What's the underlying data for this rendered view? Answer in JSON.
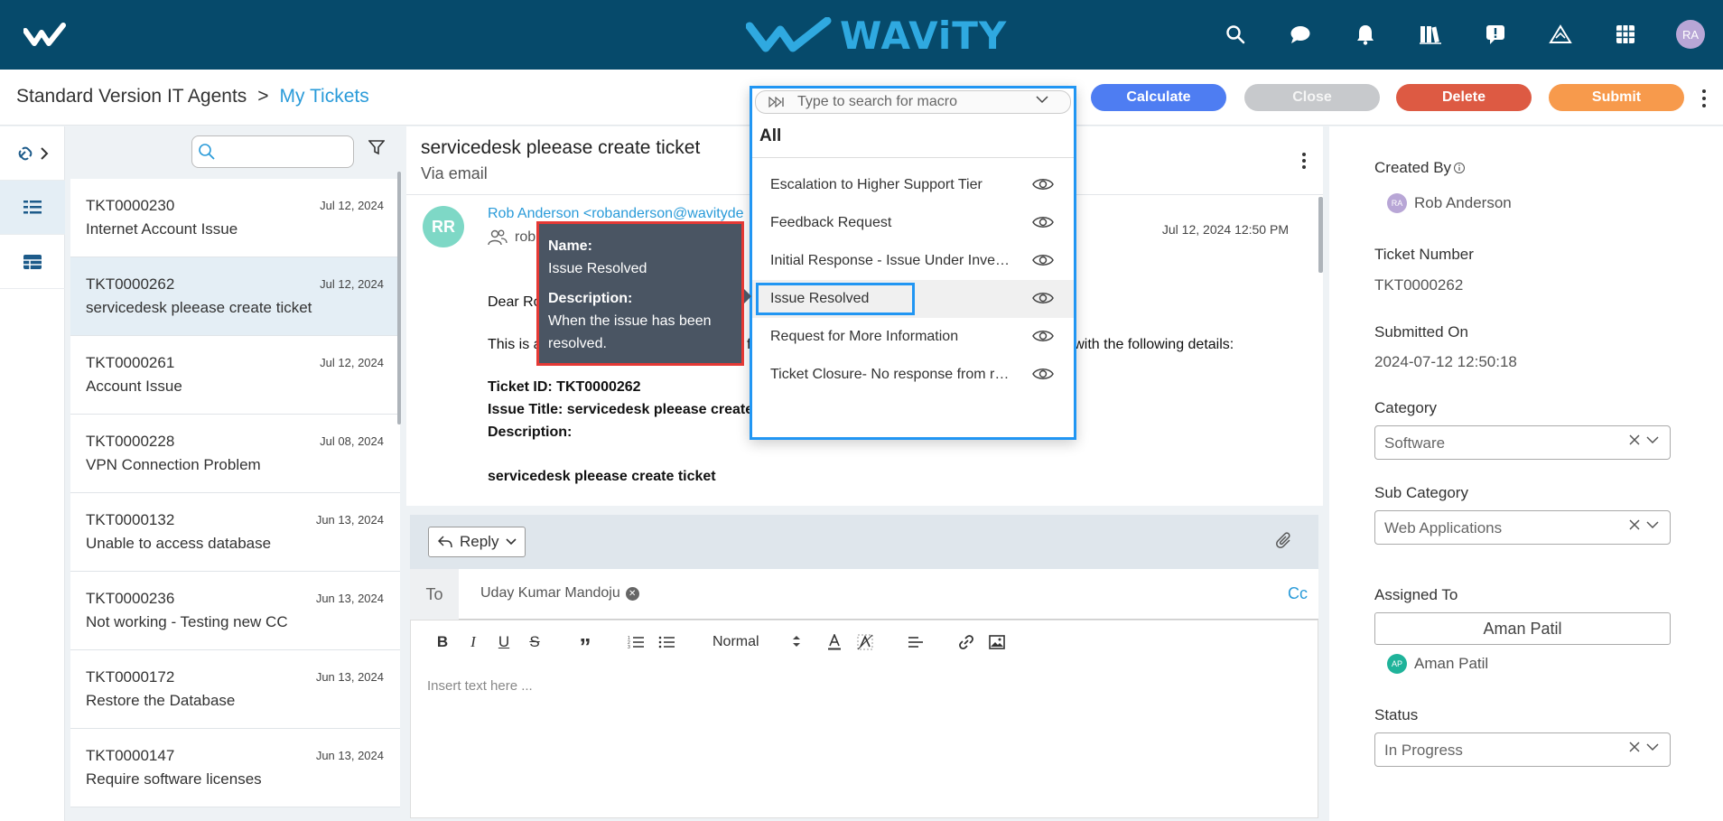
{
  "brand": {
    "name": "WAViTY"
  },
  "topbar": {
    "icons": [
      "search-icon",
      "chat-icon",
      "bell-icon",
      "library-icon",
      "feedback-icon",
      "alert-icon",
      "apps-grid-icon"
    ],
    "user_initials": "RA"
  },
  "breadcrumb": {
    "root": "Standard Version IT Agents",
    "separator": ">",
    "current": "My Tickets"
  },
  "actions": {
    "calculate": "Calculate",
    "close": "Close",
    "delete": "Delete",
    "submit": "Submit"
  },
  "macro": {
    "placeholder": "Type to search for macro",
    "group": "All",
    "items": [
      {
        "label": "Escalation to Higher Support Tier"
      },
      {
        "label": "Feedback Request"
      },
      {
        "label": "Initial Response - Issue Under Investigation"
      },
      {
        "label": "Issue Resolved"
      },
      {
        "label": "Request for More Information"
      },
      {
        "label": "Ticket Closure- No response from requester"
      }
    ],
    "tooltip": {
      "name_label": "Name:",
      "name": "Issue Resolved",
      "desc_label": "Description:",
      "desc": "When the issue has been resolved."
    }
  },
  "tickets": [
    {
      "id": "TKT0000230",
      "date": "Jul 12, 2024",
      "title": "Internet Account Issue"
    },
    {
      "id": "TKT0000262",
      "date": "Jul 12, 2024",
      "title": "servicedesk pleease create ticket"
    },
    {
      "id": "TKT0000261",
      "date": "Jul 12, 2024",
      "title": "Account Issue"
    },
    {
      "id": "TKT0000228",
      "date": "Jul 08, 2024",
      "title": "VPN Connection Problem"
    },
    {
      "id": "TKT0000132",
      "date": "Jun 13, 2024",
      "title": "Unable to access database"
    },
    {
      "id": "TKT0000236",
      "date": "Jun 13, 2024",
      "title": "Not working - Testing new CC"
    },
    {
      "id": "TKT0000172",
      "date": "Jun 13, 2024",
      "title": "Restore the Database"
    },
    {
      "id": "TKT0000147",
      "date": "Jun 13, 2024",
      "title": "Require software licenses"
    }
  ],
  "email": {
    "subject": "servicedesk pleease create ticket",
    "via": "Via email",
    "avatar": "RR",
    "from": "Rob Anderson <robanderson@wavityde",
    "recipients_partial": "rob",
    "date": "Jul 12, 2024 12:50 PM",
    "greeting": "Dear Ro",
    "line1_start": "This is a",
    "line1_mid": "fo",
    "line1_end": "ed with the following details:",
    "ticket_id": "Ticket ID: TKT0000262",
    "issue_title": "Issue Title: servicedesk pleease create",
    "description_label": "Description:",
    "description": "servicedesk pleease create ticket"
  },
  "composer": {
    "reply_label": "Reply",
    "to_label": "To",
    "to_recipient": "Uday Kumar Mandoju",
    "cc_label": "Cc",
    "format": "Normal",
    "placeholder": "Insert text here ..."
  },
  "details": {
    "created_by_label": "Created By",
    "created_by": "Rob Anderson",
    "created_by_initials": "RA",
    "ticket_number_label": "Ticket Number",
    "ticket_number": "TKT0000262",
    "submitted_on_label": "Submitted On",
    "submitted_on": "2024-07-12 12:50:18",
    "category_label": "Category",
    "category": "Software",
    "sub_category_label": "Sub Category",
    "sub_category": "Web Applications",
    "assigned_to_label": "Assigned To",
    "assigned_to": "Aman Patil",
    "assigned_initials": "AP",
    "status_label": "Status",
    "status": "In Progress"
  }
}
